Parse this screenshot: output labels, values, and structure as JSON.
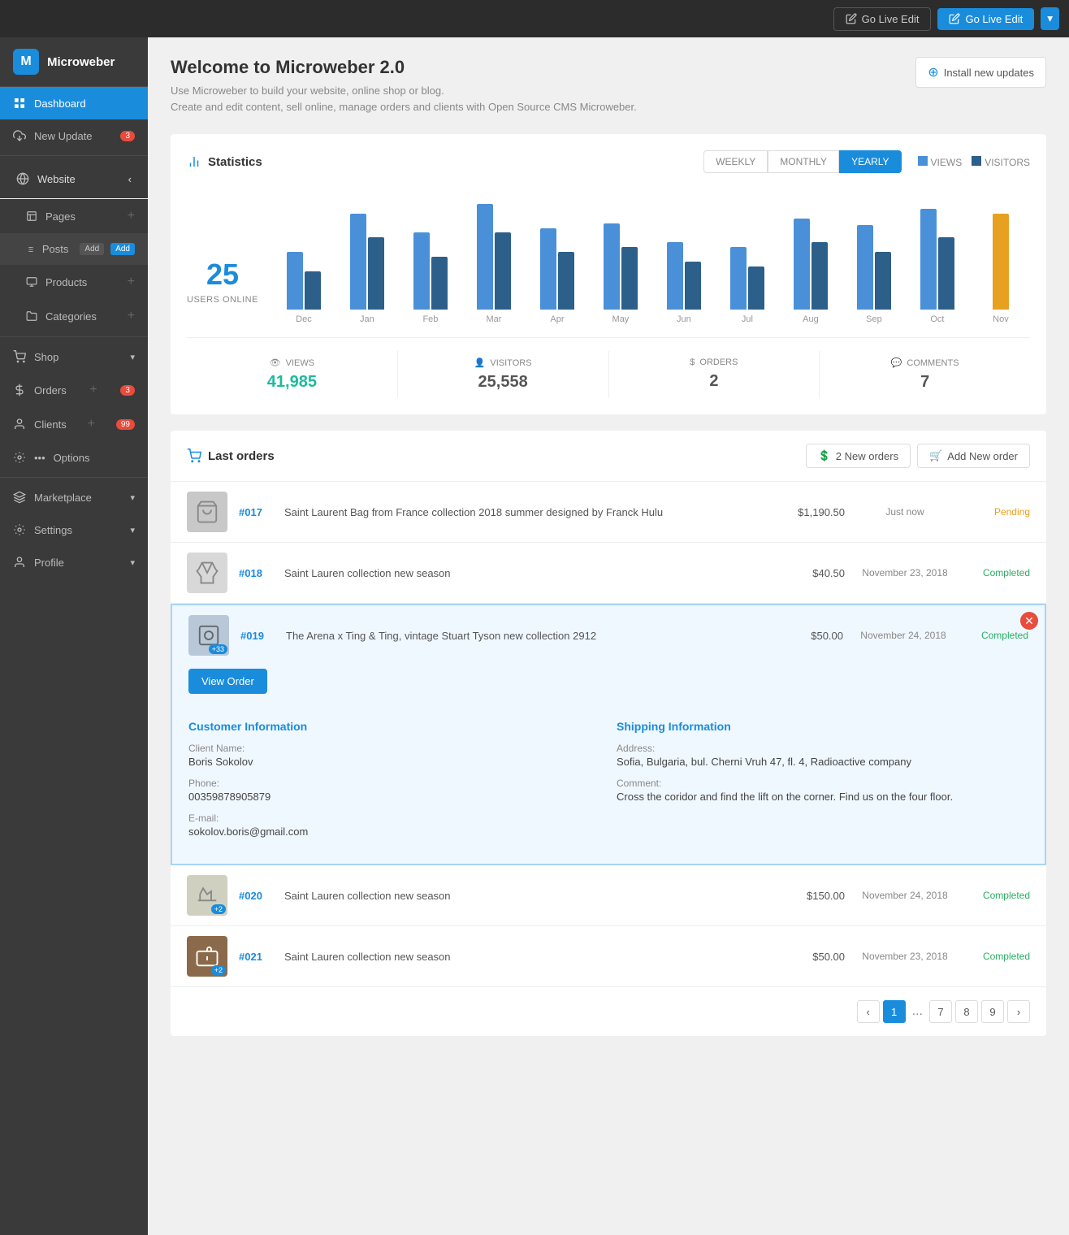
{
  "topbar": {
    "go_live_edit_outline": "Go Live Edit",
    "go_live_edit_primary": "Go Live Edit",
    "dropdown_arrow": "▾"
  },
  "sidebar": {
    "logo_text": "Microweber",
    "dashboard_label": "Dashboard",
    "new_update_label": "New Update",
    "new_update_badge": "3",
    "website_label": "Website",
    "pages_label": "Pages",
    "posts_label": "Posts",
    "posts_add1": "Add",
    "posts_add2": "Add",
    "products_label": "Products",
    "categories_label": "Categories",
    "shop_label": "Shop",
    "orders_label": "Orders",
    "orders_badge": "3",
    "clients_label": "Clients",
    "clients_badge": "99",
    "options_label": "Options",
    "marketplace_label": "Marketplace",
    "settings_label": "Settings",
    "profile_label": "Profile"
  },
  "header": {
    "title": "Welcome to Microweber 2.0",
    "subtitle_line1": "Use Microweber to build your website, online shop or blog.",
    "subtitle_line2": "Create and edit content, sell online, manage orders and clients with Open Source CMS Microweber.",
    "install_btn": "Install new updates"
  },
  "stats": {
    "title": "Statistics",
    "tabs": [
      "WEEKLY",
      "MONTHLY",
      "YEARLY"
    ],
    "active_tab": "YEARLY",
    "legend_views": "VIEWS",
    "legend_visitors": "VISITORS",
    "users_online": "25",
    "users_online_label": "USERS ONLINE",
    "bars": [
      {
        "month": "Dec",
        "views": 60,
        "visitors": 40
      },
      {
        "month": "Jan",
        "views": 100,
        "visitors": 75
      },
      {
        "month": "Feb",
        "views": 80,
        "visitors": 55
      },
      {
        "month": "Mar",
        "views": 110,
        "visitors": 80
      },
      {
        "month": "Apr",
        "views": 85,
        "visitors": 60
      },
      {
        "month": "May",
        "views": 90,
        "visitors": 65
      },
      {
        "month": "Jun",
        "views": 70,
        "visitors": 50
      },
      {
        "month": "Jul",
        "views": 65,
        "visitors": 45
      },
      {
        "month": "Aug",
        "views": 95,
        "visitors": 70
      },
      {
        "month": "Sep",
        "views": 88,
        "visitors": 60
      },
      {
        "month": "Oct",
        "views": 105,
        "visitors": 75
      },
      {
        "month": "Nov",
        "views": 100,
        "visitors": 0,
        "orange": true
      }
    ],
    "metrics": [
      {
        "label": "VIEWS",
        "value": "41,985",
        "icon": "👁",
        "color": "teal"
      },
      {
        "label": "VISITORS",
        "value": "25,558",
        "icon": "👤",
        "color": "normal"
      },
      {
        "label": "ORDERS",
        "value": "2",
        "icon": "$",
        "color": "normal"
      },
      {
        "label": "COMMENTS",
        "value": "7",
        "icon": "💬",
        "color": "normal"
      }
    ]
  },
  "orders": {
    "title": "Last orders",
    "new_orders_btn": "2 New orders",
    "add_order_btn": "Add New order",
    "rows": [
      {
        "id": "#017",
        "name": "Saint Laurent Bag from France collection 2018 summer designed by Franck Hulu",
        "price": "$1,190.50",
        "date": "Just now",
        "status": "Pending",
        "status_class": "pending",
        "thumb_type": "bag"
      },
      {
        "id": "#018",
        "name": "Saint Lauren collection new season",
        "price": "$40.50",
        "date": "November 23, 2018",
        "status": "Completed",
        "status_class": "completed",
        "thumb_type": "cloth"
      },
      {
        "id": "#019",
        "name": "The Arena x Ting & Ting, vintage Stuart Tyson new collection 2912",
        "price": "$50.00",
        "date": "November 24, 2018",
        "status": "Completed",
        "status_class": "completed",
        "thumb_type": "arena",
        "thumb_badge": "+33",
        "expanded": true,
        "view_order_btn": "View Order",
        "customer_info": {
          "title": "Customer Information",
          "client_name_label": "Client Name:",
          "client_name": "Boris Sokolov",
          "phone_label": "Phone:",
          "phone": "00359878905879",
          "email_label": "E-mail:",
          "email": "sokolov.boris@gmail.com"
        },
        "shipping_info": {
          "title": "Shipping Information",
          "address_label": "Address:",
          "address": "Sofia, Bulgaria, bul. Cherni Vruh 47, fl. 4, Radioactive company",
          "comment_label": "Comment:",
          "comment": "Cross the coridor and find the lift on the corner. Find us on the four floor."
        }
      },
      {
        "id": "#020",
        "name": "Saint Lauren collection new season",
        "price": "$150.00",
        "date": "November 24, 2018",
        "status": "Completed",
        "status_class": "completed",
        "thumb_type": "shoes",
        "thumb_badge": "+2"
      },
      {
        "id": "#021",
        "name": "Saint Lauren collection new season",
        "price": "$50.00",
        "date": "November 23, 2018",
        "status": "Completed",
        "status_class": "completed",
        "thumb_type": "brown",
        "thumb_badge": "+2"
      }
    ],
    "pagination": {
      "prev": "‹",
      "next": "›",
      "pages": [
        "1",
        "...",
        "7",
        "8",
        "9"
      ],
      "active": "1"
    }
  }
}
